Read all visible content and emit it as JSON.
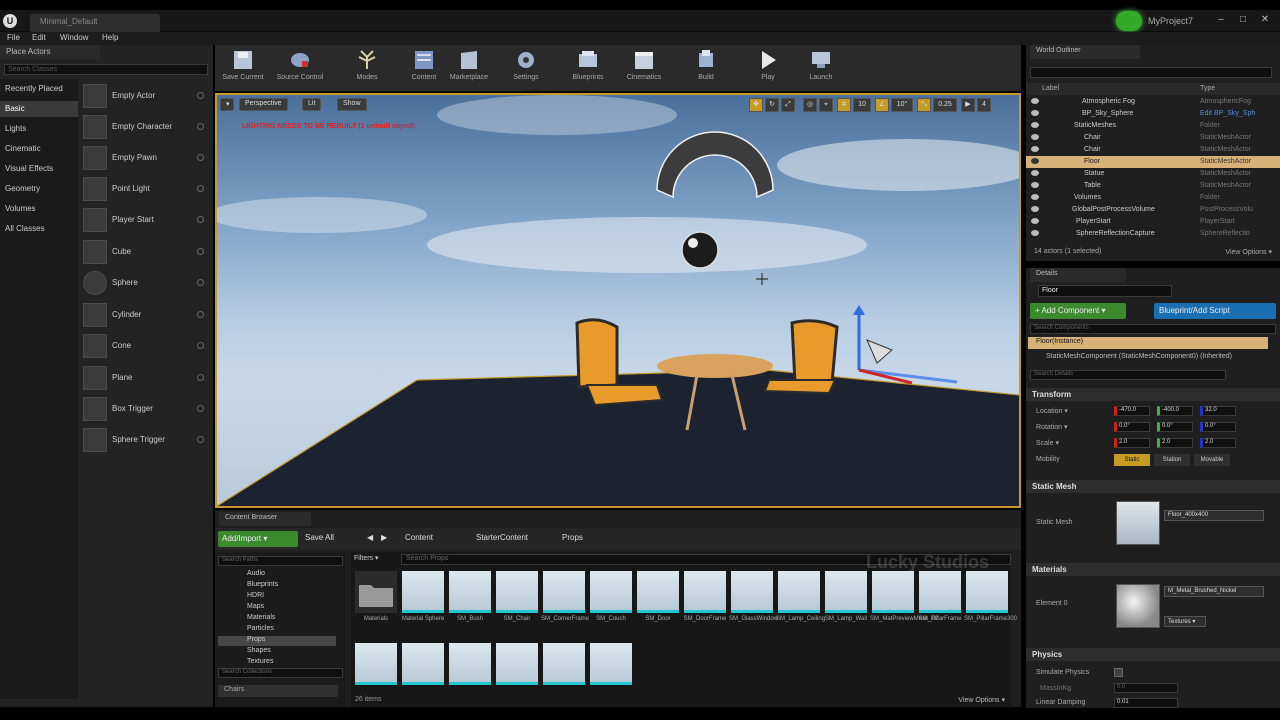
{
  "titlebar": {
    "logo": "U",
    "level_tab": "Minimal_Default",
    "project_name": "MyProject7",
    "window_buttons": [
      "minimize-icon",
      "maximize-icon",
      "close-icon"
    ]
  },
  "menubar": [
    "File",
    "Edit",
    "Window",
    "Help"
  ],
  "place_actors": {
    "tab": "Place Actors",
    "search_placeholder": "Search Classes",
    "categories": [
      "Recently Placed",
      "Basic",
      "Lights",
      "Cinematic",
      "Visual Effects",
      "Geometry",
      "Volumes",
      "All Classes"
    ],
    "selected_category": "Basic",
    "actors": [
      "Empty Actor",
      "Empty Character",
      "Empty Pawn",
      "Point Light",
      "Player Start",
      "Cube",
      "Sphere",
      "Cylinder",
      "Cone",
      "Plane",
      "Box Trigger",
      "Sphere Trigger"
    ]
  },
  "toolbar": {
    "buttons": [
      "Save Current",
      "Source Control",
      "Modes",
      "Content",
      "Marketplace",
      "Settings",
      "Blueprints",
      "Cinematics",
      "Build",
      "Play",
      "Launch"
    ]
  },
  "viewport": {
    "perspective": "Perspective",
    "lit": "Lit",
    "show": "Show",
    "warning": "LIGHTING NEEDS TO BE REBUILT (1 unbuilt object)",
    "right_tools": [
      "10",
      "10°",
      "0.25",
      "4"
    ]
  },
  "content_browser": {
    "tab": "Content Browser",
    "add_import": "Add/Import ▾",
    "save_all": "Save All",
    "breadcrumbs": [
      "Content",
      "StarterContent",
      "Props"
    ],
    "search_paths": "Search Paths",
    "folders": [
      "Audio",
      "Blueprints",
      "HDRI",
      "Maps",
      "Materials",
      "Particles",
      "Props",
      "Shapes",
      "Textures"
    ],
    "selected_folder": "Props",
    "search_collections": "Search Collections",
    "collection": "Chairs",
    "filters": "Filters ▾",
    "search_props": "Search Props",
    "assets_row1": [
      "Materials",
      "Material Sphere",
      "SM_Bush",
      "SM_Chair",
      "SM_CornerFrame",
      "SM_Couch",
      "SM_Door",
      "SM_DoorFrame",
      "SM_GlassWindow",
      "SM_Lamp_Ceiling",
      "SM_Lamp_Wall",
      "SM_MatPreviewMesh_02",
      "SM_PillarFrame",
      "SM_PillarFrame300"
    ],
    "assets_row2": [
      "",
      "",
      "",
      "",
      "",
      ""
    ],
    "item_count": "26 items",
    "view_options": "View Options ▾",
    "watermark": "Lucky Studios"
  },
  "world_outliner": {
    "tab": "World Outliner",
    "col_label": "Label",
    "col_type": "Type",
    "rows": [
      {
        "label": "Atmospheric Fog",
        "type": "AtmosphericFog",
        "indent": 1
      },
      {
        "label": "BP_Sky_Sphere",
        "type": "Edit BP_Sky_Sph",
        "indent": 1
      },
      {
        "label": "StaticMeshes",
        "type": "Folder",
        "indent": 0
      },
      {
        "label": "Chair",
        "type": "StaticMeshActor",
        "indent": 2
      },
      {
        "label": "Chair",
        "type": "StaticMeshActor",
        "indent": 2
      },
      {
        "label": "Floor",
        "type": "StaticMeshActor",
        "indent": 2
      },
      {
        "label": "Statue",
        "type": "StaticMeshActor",
        "indent": 2
      },
      {
        "label": "Table",
        "type": "StaticMeshActor",
        "indent": 2
      },
      {
        "label": "Volumes",
        "type": "Folder",
        "indent": 0
      },
      {
        "label": "GlobalPostProcessVolume",
        "type": "PostProcessVolu",
        "indent": 1
      },
      {
        "label": "PlayerStart",
        "type": "PlayerStart",
        "indent": 1
      },
      {
        "label": "SphereReflectionCapture",
        "type": "SphereReflectio",
        "indent": 1
      }
    ],
    "selected_row": "Floor",
    "footer": "14 actors (1 selected)",
    "view_options": "View Options ▾"
  },
  "details": {
    "tab": "Details",
    "name": "Floor",
    "add_component": "+ Add Component ▾",
    "blueprint_script": "Blueprint/Add Script",
    "search_components": "Search Components",
    "instance": "Floor(Instance)",
    "mesh_component": "StaticMeshComponent (StaticMeshComponent0) (Inherited)",
    "search_details": "Search Details",
    "transform": "Transform",
    "location_label": "Location ▾",
    "location": [
      "-470.0",
      "-400.0",
      "32.0"
    ],
    "rotation_label": "Rotation ▾",
    "rotation": [
      "0.0°",
      "0.0°",
      "0.0°"
    ],
    "scale_label": "Scale ▾",
    "scale": [
      "2.0",
      "2.0",
      "2.0"
    ],
    "mobility_label": "Mobility",
    "mobility": [
      "Static",
      "Station",
      "Movable"
    ],
    "static_mesh_section": "Static Mesh",
    "static_mesh_label": "Static Mesh",
    "static_mesh_value": "Floor_400x400",
    "materials_section": "Materials",
    "element_label": "Element 0",
    "material_value": "M_Metal_Brushed_Nickel",
    "textures": "Textures ▾",
    "physics_section": "Physics",
    "simulate_physics": "Simulate Physics",
    "mass": "MassInKg",
    "mass_value": "0.0",
    "linear_damping": "Linear Damping",
    "linear_damping_value": "0.01"
  }
}
